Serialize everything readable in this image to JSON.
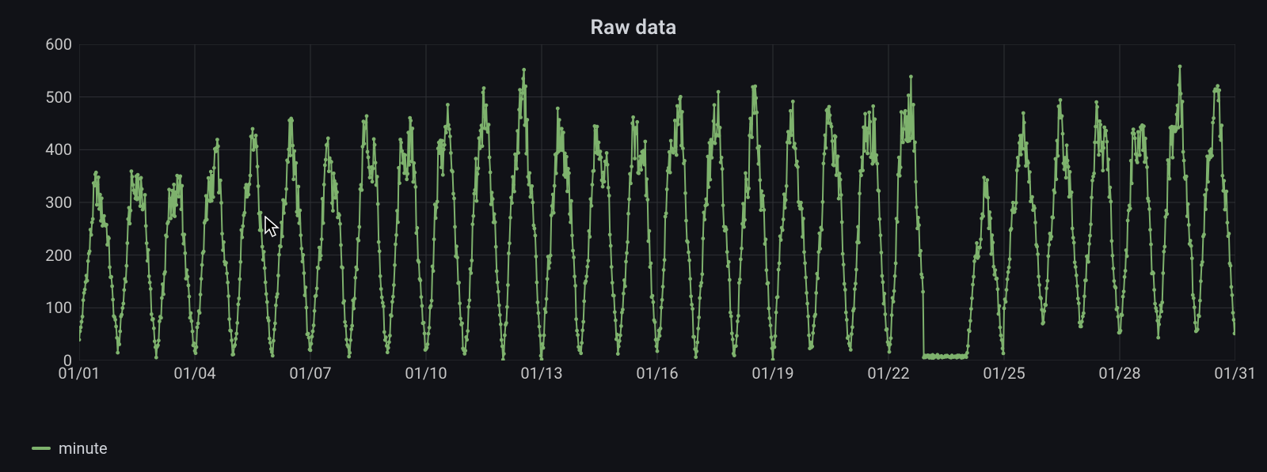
{
  "title": "Raw data",
  "legend": {
    "label": "minute",
    "color": "#7eb26d"
  },
  "colors": {
    "series": "#7eb26d",
    "grid": "#2f3136",
    "bg": "#111217",
    "text": "#c7c7c7"
  },
  "cursor": {
    "xpx": 334,
    "ypx": 273
  },
  "chart_data": {
    "type": "line",
    "title": "Raw data",
    "xlabel": "",
    "ylabel": "",
    "ylim": [
      0,
      600
    ],
    "y_ticks": [
      0,
      100,
      200,
      300,
      400,
      500,
      600
    ],
    "x_ticks": [
      "01/01",
      "01/04",
      "01/07",
      "01/10",
      "01/13",
      "01/16",
      "01/19",
      "01/22",
      "01/25",
      "01/28",
      "01/31"
    ],
    "x_range_days": 31,
    "series": [
      {
        "name": "minute",
        "color": "#7eb26d",
        "daily_peaks": [
          340,
          390,
          360,
          400,
          425,
          435,
          400,
          465,
          460,
          475,
          490,
          540,
          465,
          455,
          475,
          500,
          485,
          480,
          475,
          490,
          500,
          525,
          490,
          325,
          440,
          460,
          475,
          465,
          525,
          520,
          480
        ],
        "daily_troughs": [
          45,
          20,
          15,
          15,
          10,
          10,
          15,
          10,
          15,
          10,
          15,
          15,
          15,
          15,
          15,
          15,
          15,
          20,
          15,
          15,
          20,
          15,
          5,
          5,
          100,
          60,
          55,
          60,
          50,
          55,
          60
        ],
        "anomaly_flat_range": {
          "start_day": 22.9,
          "end_day": 24.0,
          "value": 8
        }
      }
    ]
  }
}
